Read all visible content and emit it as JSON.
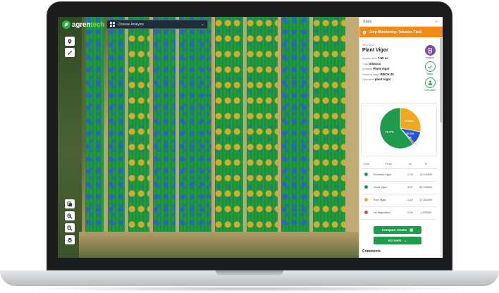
{
  "app": {
    "logo_left": "agren",
    "logo_right": "tech"
  },
  "toolbar": {
    "analysis_placeholder": "Choose Analysis"
  },
  "panel": {
    "header_title": "Stats",
    "field_name": "Crop Monitoring- Tobacco Field",
    "date": "09/17/2020",
    "heading": "Plant Vigor",
    "rows": [
      {
        "label": "Applied field",
        "value": "7.50 ac"
      },
      {
        "label": "Crop",
        "value": "tobacco"
      },
      {
        "label": "Analysis",
        "value": "Plant Vigor"
      },
      {
        "label": "Growing stage",
        "value": "BBCH 35"
      },
      {
        "label": "Operation",
        "value": "plant vigor"
      }
    ],
    "actions": [
      {
        "label": "Analysis",
        "color": "#7b4fa6",
        "icon": "analysis-icon"
      },
      {
        "label": "Status",
        "color": "#34a853",
        "icon": "check-icon"
      },
      {
        "label": "Consultant",
        "color": "#34a853",
        "icon": "consultant-icon"
      }
    ],
    "table": {
      "headers": [
        "Color",
        "Desc.",
        "ac",
        "%"
      ],
      "rows": [
        {
          "color": "#1e9b4b",
          "desc": "Excellent Vigor",
          "ac": "0.76",
          "pct": "10.100000"
        },
        {
          "color": "#1e9b4b",
          "desc": "Good Vigor",
          "ac": "4.57",
          "pct": "60.740000"
        },
        {
          "color": "#f0a81e",
          "desc": "Poor Vigor",
          "ac": "2.10",
          "pct": "27.910000"
        },
        {
          "color": "#e0454a",
          "desc": "No Vegetation",
          "ac": "0.09",
          "pct": "1.200000"
        }
      ]
    },
    "compare_label": "Compare results",
    "ag_tools_label": "AG tools",
    "comments_label": "Comments"
  },
  "chart_data": {
    "type": "pie",
    "slices": [
      {
        "label": "60.77%",
        "value": 60.77,
        "color": "#1e9b4b"
      },
      {
        "label": "27.82%",
        "value": 27.82,
        "color": "#f0a81e"
      },
      {
        "label": "10.11%",
        "value": 10.11,
        "color": "#2457d6"
      },
      {
        "label": "1.2%",
        "value": 1.2,
        "color": "#e0454a"
      }
    ]
  },
  "colors": {
    "accent_orange": "#f08a18",
    "accent_green": "#1e9b4b"
  }
}
